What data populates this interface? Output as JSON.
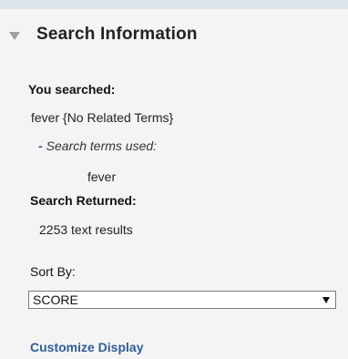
{
  "panel": {
    "title": "Search Information",
    "you_searched_label": "You searched:",
    "query_text": "fever {No Related Terms}",
    "terms_used_dash": "-",
    "terms_used_label": "Search terms used:",
    "term": "fever",
    "returned_label": "Search Returned:",
    "results_text": "2253 text results",
    "sort_label": "Sort By:",
    "sort_value": "SCORE",
    "customize_link": "Customize Display"
  },
  "colors": {
    "background": "#dde4ec",
    "panel": "#f4f4f4",
    "link": "#2f5e97"
  },
  "icons": {
    "collapse": "triangle-down-icon",
    "dropdown": "dropdown-arrow-icon"
  }
}
